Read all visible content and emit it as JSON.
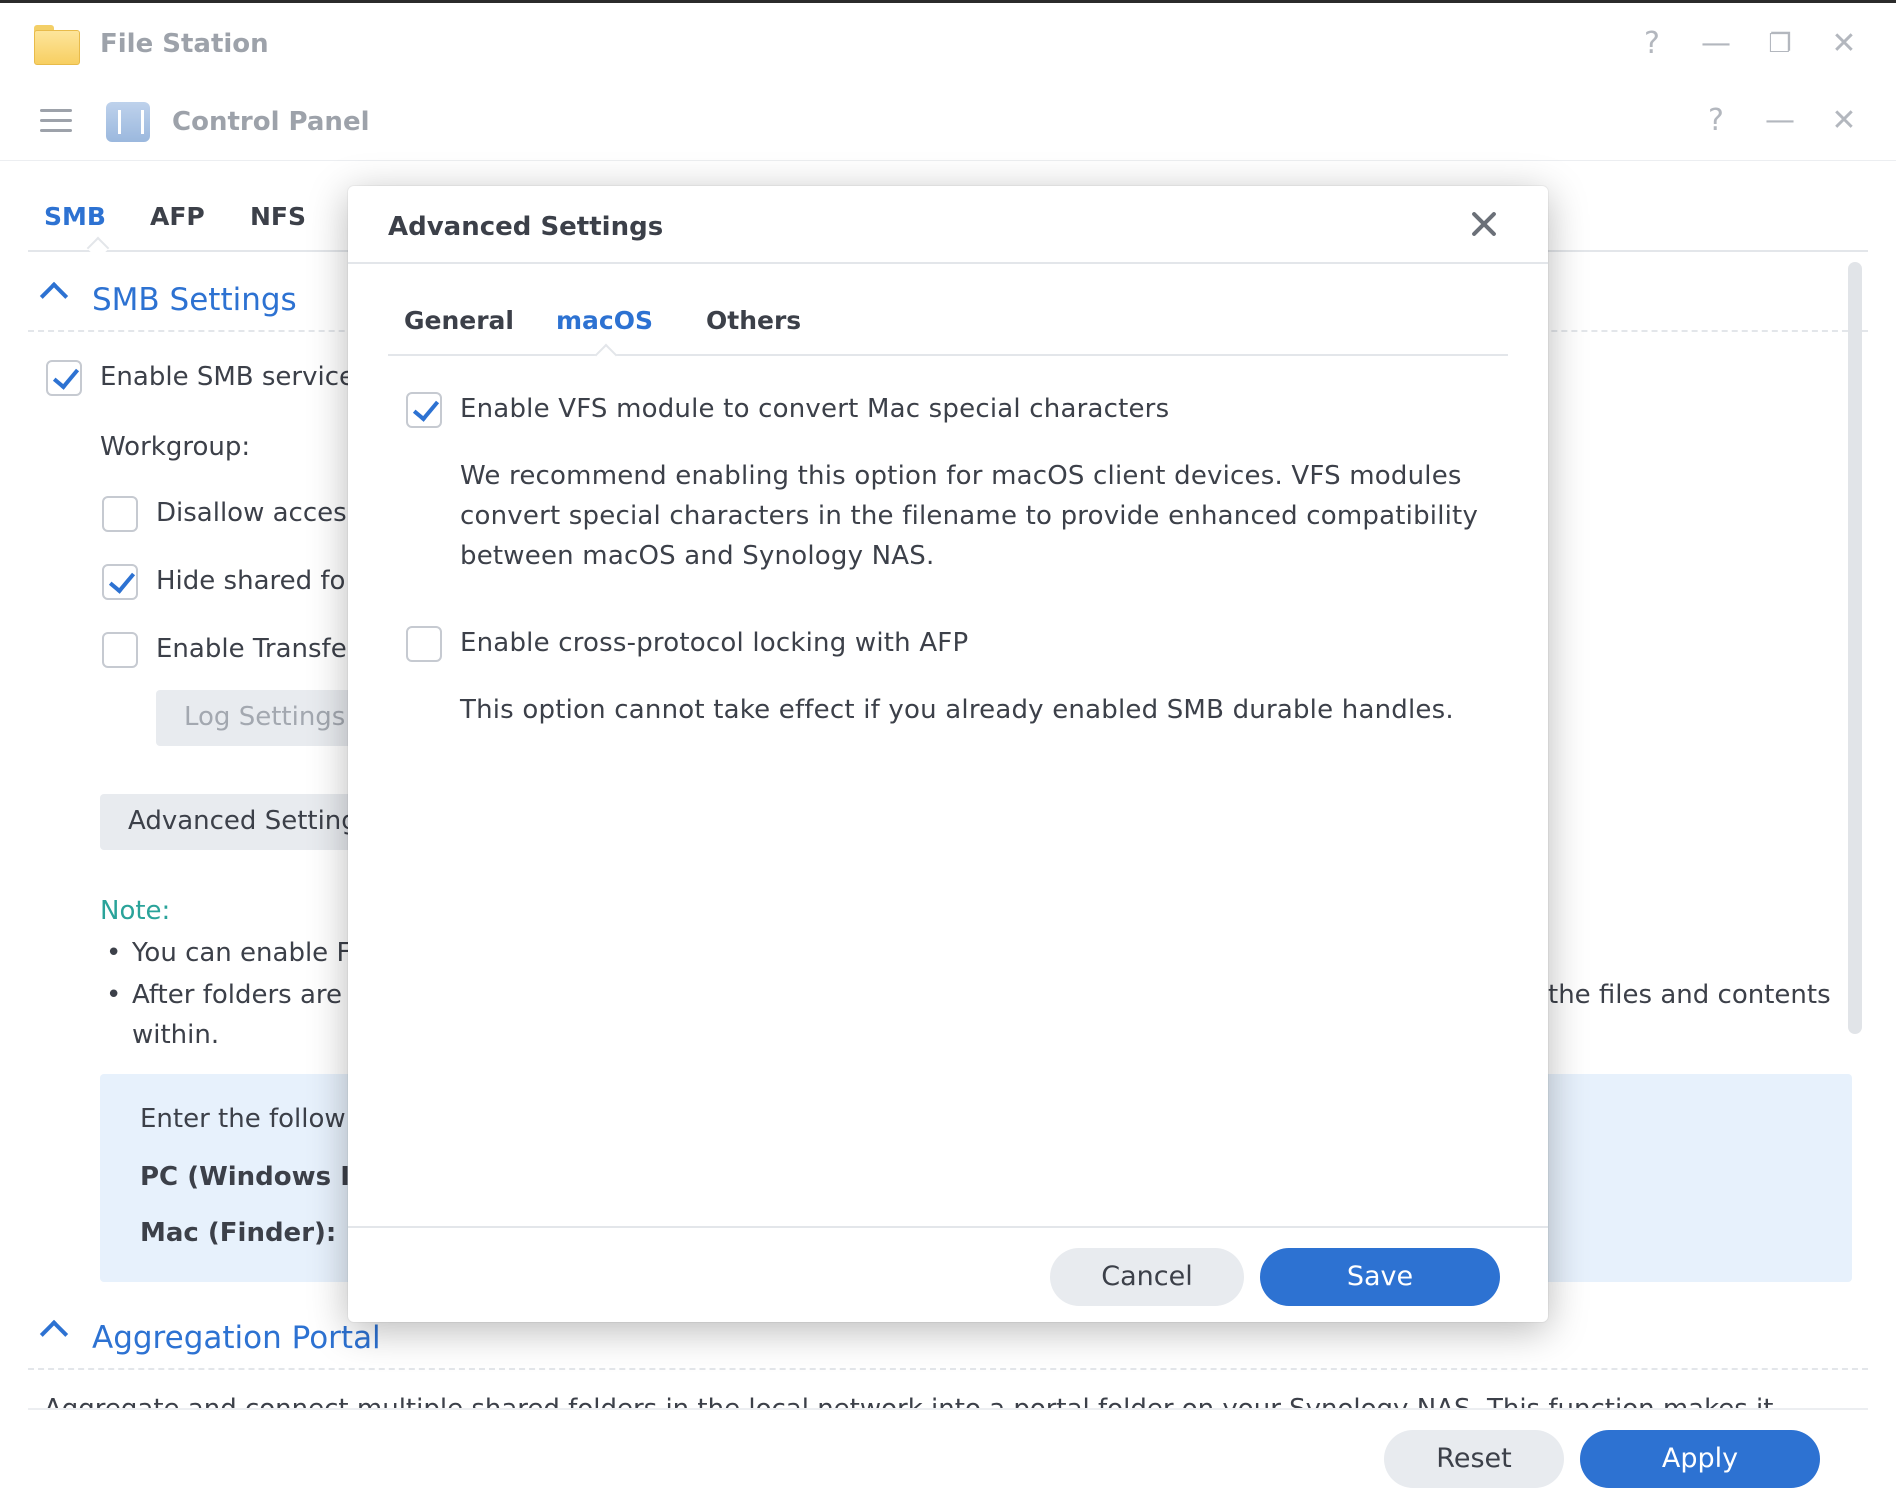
{
  "file_station": {
    "title": "File Station",
    "controls": {
      "help": "?",
      "minimize": "—",
      "restore": "❐",
      "close": "✕"
    }
  },
  "control_panel": {
    "title": "Control Panel",
    "controls": {
      "help": "?",
      "minimize": "—",
      "close": "✕"
    },
    "tabs": [
      "SMB",
      "AFP",
      "NFS"
    ],
    "active_tab": "SMB",
    "smb_section": {
      "title": "SMB Settings",
      "enable_smb": {
        "label": "Enable SMB service",
        "checked": true
      },
      "workgroup_label": "Workgroup:",
      "disallow_access": {
        "label": "Disallow access",
        "checked": false
      },
      "hide_shared": {
        "label": "Hide shared fo",
        "checked": true
      },
      "enable_transfer": {
        "label": "Enable Transfe",
        "checked": false
      },
      "log_settings_label": "Log Settings",
      "advanced_settings_label": "Advanced Settings",
      "note_label": "Note:",
      "note_bullets": [
        "You can enable F",
        "After folders are",
        "the files and contents",
        "within."
      ],
      "info_box": {
        "line1": "Enter the follow",
        "pc_label": "PC (Windows I",
        "mac_label": "Mac (Finder):"
      }
    },
    "aggregation_section": {
      "title": "Aggregation Portal",
      "text": "Aggregate and connect multiple shared folders in the local network into a portal folder on your Synology NAS. This function makes it"
    },
    "footer": {
      "reset_label": "Reset",
      "apply_label": "Apply"
    }
  },
  "modal": {
    "title": "Advanced Settings",
    "tabs": [
      "General",
      "macOS",
      "Others"
    ],
    "active_tab": "macOS",
    "options": [
      {
        "label": "Enable VFS module to convert Mac special characters",
        "checked": true,
        "description_lines": [
          "We recommend enabling this option for macOS client devices. VFS modules",
          "convert special characters in the filename to provide enhanced compatibility",
          "between macOS and Synology NAS."
        ]
      },
      {
        "label": "Enable cross-protocol locking with AFP",
        "checked": false,
        "description_lines": [
          "This option cannot take effect if you already enabled SMB durable handles."
        ]
      }
    ],
    "cancel_label": "Cancel",
    "save_label": "Save"
  },
  "colors": {
    "accent": "#2d72d2",
    "note": "#2aa39a",
    "info_bg": "#e7f1fc"
  },
  "icons": {
    "file_station": "folder-icon",
    "control_panel": "control-panel-icon",
    "menu": "hamburger-icon"
  }
}
